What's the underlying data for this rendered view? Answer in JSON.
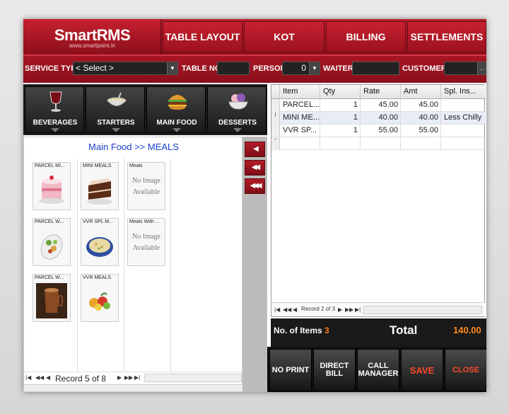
{
  "app": {
    "name": "SmartRMS",
    "url": "www.smartpoint.in"
  },
  "tabs": [
    {
      "label": "TABLE LAYOUT"
    },
    {
      "label": "KOT"
    },
    {
      "label": "BILLING"
    },
    {
      "label": "SETTLEMENTS"
    }
  ],
  "filters": {
    "service_type_label": "SERVICE TYPE",
    "service_type_value": "< Select >",
    "table_no_label": "TABLE NO",
    "table_no_value": "",
    "person_label": "PERSON",
    "person_value": "0",
    "waiter_label": "WAITER",
    "waiter_value": "",
    "customer_label": "CUSTOMER",
    "customer_value": "",
    "customer_more": "..."
  },
  "categories": [
    {
      "label": "BEVERAGES",
      "icon": "wine-glass-icon"
    },
    {
      "label": "STARTERS",
      "icon": "soup-bowl-icon"
    },
    {
      "label": "MAIN FOOD",
      "icon": "burger-icon"
    },
    {
      "label": "DESSERTS",
      "icon": "ice-cream-icon"
    }
  ],
  "breadcrumb": "Main Food >> MEALS",
  "items": [
    {
      "title": "PARCEL MI...",
      "image": "cake-slice-icon"
    },
    {
      "title": "MINI MEALS",
      "image": "chocolate-cake-icon"
    },
    {
      "title": "Meals",
      "no_image": "No Image Available"
    },
    {
      "title": "PARCEL W...",
      "image": "salad-plate-icon"
    },
    {
      "title": "VVR  SPL M...",
      "image": "rice-bowl-icon"
    },
    {
      "title": "Meals With ...",
      "no_image": "No Image Available"
    },
    {
      "title": "PARCEL W...",
      "image": "drink-cup-icon"
    },
    {
      "title": "VVR MEALS",
      "image": "fruit-icon"
    }
  ],
  "item_nav": {
    "record_text": "Record 5 of 8"
  },
  "order": {
    "columns": [
      "Item",
      "Qty",
      "Rate",
      "Amt",
      "Spl. Ins..."
    ],
    "rows": [
      {
        "item": "PARCEL...",
        "qty": "1",
        "rate": "45.00",
        "amt": "45.00",
        "spl": ""
      },
      {
        "item": "MINI ME...",
        "qty": "1",
        "rate": "40.00",
        "amt": "40.00",
        "spl": "Less Chilly"
      },
      {
        "item": "VVR  SP...",
        "qty": "1",
        "rate": "55.00",
        "amt": "55.00",
        "spl": ""
      }
    ],
    "record_text": "Record 2 of 3"
  },
  "totals": {
    "items_label": "No. of Items",
    "items_count": "3",
    "total_label": "Total",
    "total_value": "140.00"
  },
  "actions": [
    {
      "label": "NO PRINT"
    },
    {
      "label": "DIRECT BILL"
    },
    {
      "label": "CALL MANAGER"
    },
    {
      "label": "SAVE"
    },
    {
      "label": "CLOSE"
    }
  ],
  "colors": {
    "brand_red": "#b81c2a",
    "accent_orange": "#ff8a1a",
    "link_blue": "#1a3ec9"
  }
}
